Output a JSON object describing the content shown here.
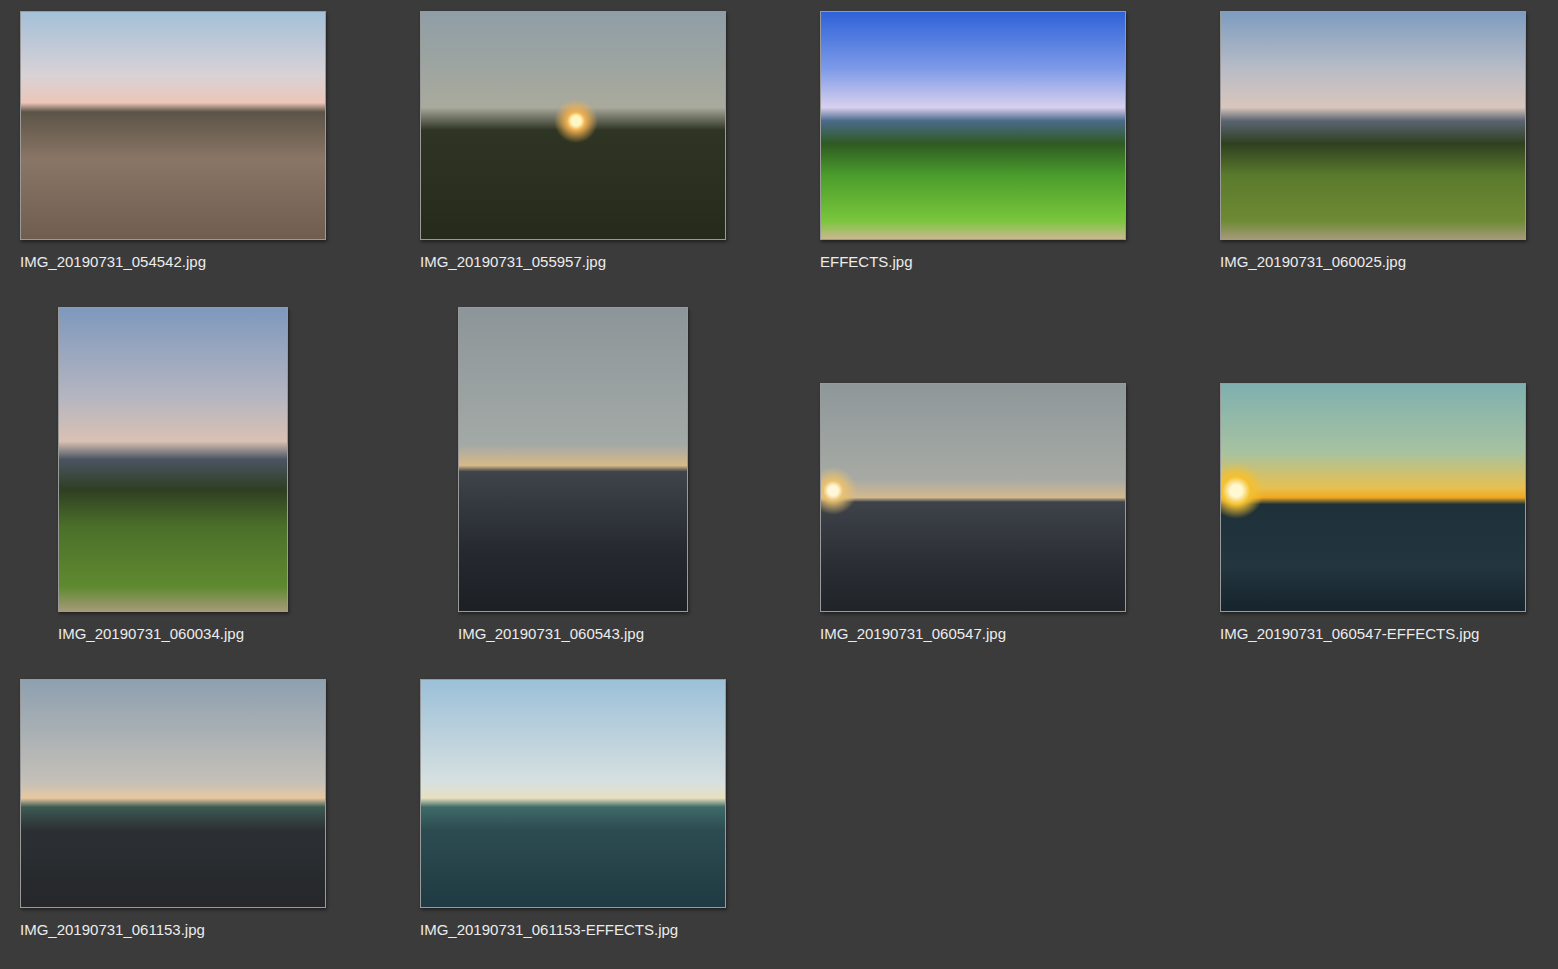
{
  "files": [
    {
      "name": "IMG_20190731_054542.jpg",
      "kind": "landscape"
    },
    {
      "name": "IMG_20190731_055957.jpg",
      "kind": "landscape"
    },
    {
      "name": "EFFECTS.jpg",
      "kind": "landscape"
    },
    {
      "name": "IMG_20190731_060025.jpg",
      "kind": "landscape"
    },
    {
      "name": "IMG_20190731_060034.jpg",
      "kind": "portrait"
    },
    {
      "name": "IMG_20190731_060543.jpg",
      "kind": "portrait"
    },
    {
      "name": "IMG_20190731_060547.jpg",
      "kind": "landscape"
    },
    {
      "name": "IMG_20190731_060547-EFFECTS.jpg",
      "kind": "landscape"
    },
    {
      "name": "IMG_20190731_061153.jpg",
      "kind": "landscape"
    },
    {
      "name": "IMG_20190731_061153-EFFECTS.jpg",
      "kind": "landscape"
    }
  ]
}
